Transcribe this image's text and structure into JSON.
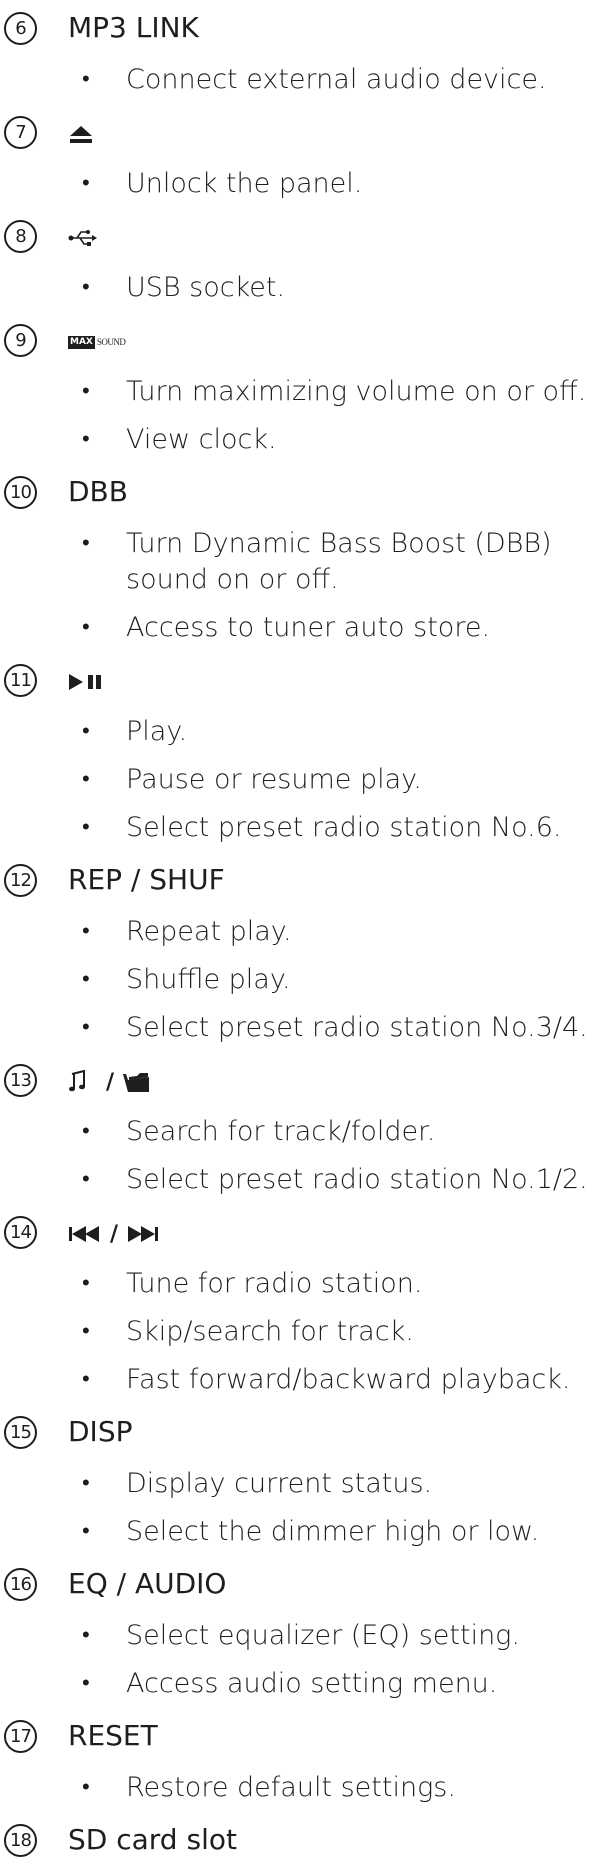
{
  "items": [
    {
      "num": "6",
      "title": "MP3 LINK",
      "bullets": [
        "Connect external audio device."
      ]
    },
    {
      "num": "7",
      "icon": "eject-icon",
      "bullets": [
        "Unlock the panel."
      ]
    },
    {
      "num": "8",
      "icon": "usb-icon",
      "bullets": [
        "USB socket."
      ]
    },
    {
      "num": "9",
      "icon_badge": "MAX",
      "icon_text": "SOUND",
      "bullets": [
        "Turn maximizing volume on or off.",
        "View clock."
      ]
    },
    {
      "num": "10",
      "title": "DBB",
      "bullets": [
        "Turn Dynamic Bass Boost (DBB) sound on or off.",
        "Access to tuner auto store."
      ]
    },
    {
      "num": "11",
      "icon": "play-pause-icon",
      "bullets": [
        "Play.",
        "Pause or resume play.",
        "Select preset radio station No.6."
      ]
    },
    {
      "num": "12",
      "title": "REP / SHUF",
      "bullets": [
        "Repeat play.",
        "Shuffle play.",
        "Select preset radio station No.3/4."
      ]
    },
    {
      "num": "13",
      "icon": "music-note-folder-icon",
      "bullets": [
        "Search for track/folder.",
        "Select preset radio station No.1/2."
      ]
    },
    {
      "num": "14",
      "icon": "prev-next-icon",
      "bullets": [
        "Tune for radio station.",
        "Skip/search for track.",
        "Fast forward/backward playback."
      ]
    },
    {
      "num": "15",
      "title": "DISP",
      "bullets": [
        "Display current status.",
        "Select the dimmer high or low."
      ]
    },
    {
      "num": "16",
      "title": "EQ / AUDIO",
      "bullets": [
        "Select equalizer (EQ) setting.",
        "Access audio setting menu."
      ]
    },
    {
      "num": "17",
      "title": "RESET",
      "bullets": [
        "Restore default settings."
      ]
    },
    {
      "num": "18",
      "title": "SD card slot",
      "bullets": []
    }
  ],
  "slash": "/"
}
